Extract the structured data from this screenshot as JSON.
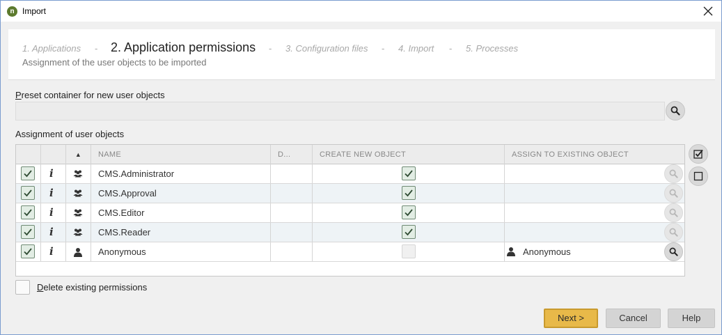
{
  "window": {
    "title": "Import",
    "app_icon_letter": "n"
  },
  "wizard": {
    "steps": [
      {
        "label": "1. Applications"
      },
      {
        "label": "2. Application permissions"
      },
      {
        "label": "3. Configuration files"
      },
      {
        "label": "4. Import"
      },
      {
        "label": "5. Processes"
      }
    ],
    "separator": "-",
    "subtitle": "Assignment of the user objects to be imported"
  },
  "preset": {
    "label_first": "P",
    "label_rest": "reset container for new user objects",
    "value": ""
  },
  "assignment": {
    "label": "Assignment of user objects",
    "columns": {
      "sort": "▲",
      "name": "NAME",
      "d": "D...",
      "create": "CREATE NEW OBJECT",
      "assign": "ASSIGN TO EXISTING OBJECT"
    },
    "rows": [
      {
        "selected": true,
        "type_icon": "group-icon",
        "name": "CMS.Administrator",
        "create_new": true,
        "create_enabled": true,
        "assigned": "",
        "search_enabled": false
      },
      {
        "selected": true,
        "type_icon": "group-icon",
        "name": "CMS.Approval",
        "create_new": true,
        "create_enabled": true,
        "assigned": "",
        "search_enabled": false
      },
      {
        "selected": true,
        "type_icon": "group-icon",
        "name": "CMS.Editor",
        "create_new": true,
        "create_enabled": true,
        "assigned": "",
        "search_enabled": false
      },
      {
        "selected": true,
        "type_icon": "group-icon",
        "name": "CMS.Reader",
        "create_new": true,
        "create_enabled": true,
        "assigned": "",
        "search_enabled": false
      },
      {
        "selected": true,
        "type_icon": "user-icon",
        "name": "Anonymous",
        "create_new": false,
        "create_enabled": false,
        "assigned": "Anonymous",
        "search_enabled": true
      }
    ]
  },
  "delete_existing": {
    "checked": false,
    "label_first": "D",
    "label_rest": "elete existing permissions"
  },
  "buttons": {
    "next": "Next >",
    "cancel": "Cancel",
    "help": "Help"
  },
  "colors": {
    "primary_button": "#e8b949",
    "checkbox_checked": "#e2ede4",
    "alt_row": "#eef3f6"
  }
}
